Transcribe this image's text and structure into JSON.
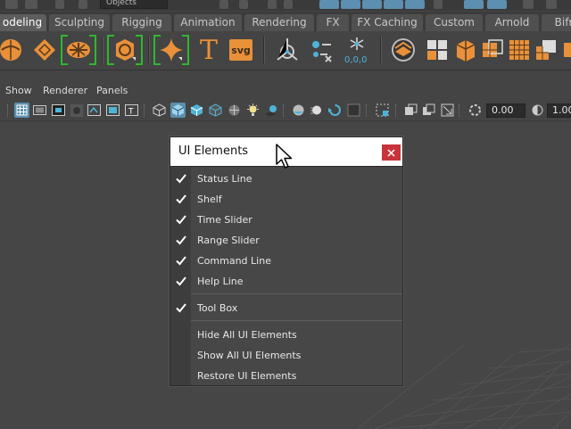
{
  "status_line": {
    "object_mode_value": "Objects"
  },
  "shelf": {
    "tabs": [
      {
        "label": "odeling",
        "active": true
      },
      {
        "label": "Sculpting",
        "active": false
      },
      {
        "label": "Rigging",
        "active": false
      },
      {
        "label": "Animation",
        "active": false
      },
      {
        "label": "Rendering",
        "active": false
      },
      {
        "label": "FX",
        "active": false
      },
      {
        "label": "FX Caching",
        "active": false
      },
      {
        "label": "Custom",
        "active": false
      },
      {
        "label": "Arnold",
        "active": false
      },
      {
        "label": "Bifr",
        "active": false
      }
    ],
    "text_icon": "T",
    "svg_icon": "svg",
    "icons": [
      "poly-sphere-icon",
      "poly-cube-icon",
      "poly-cylinder-icon",
      "poly-torus-icon",
      "poly-platonic-icon",
      "text-tool-icon",
      "svg-tool-icon",
      "measure-tool-icon",
      "type-tool-icon",
      "snowflake-icon",
      "sphere-layer-icon",
      "combine-icon",
      "separate-icon",
      "extract-icon",
      "smooth-icon",
      "bevel-icon"
    ],
    "accent_color": "#e8913a",
    "bracket_color": "#2fb82f"
  },
  "panel_menubar": {
    "items": [
      "Show",
      "Renderer",
      "Panels"
    ]
  },
  "panel_toolbar": {
    "field_1": "0.00",
    "field_2": "1.00",
    "pressed_color": "#5c8fb0"
  },
  "dialog": {
    "title": "UI Elements",
    "close_color": "#c8343a",
    "groups": [
      [
        {
          "label": "Status Line",
          "checked": true
        },
        {
          "label": "Shelf",
          "checked": true
        },
        {
          "label": "Time Slider",
          "checked": true
        },
        {
          "label": "Range Slider",
          "checked": true
        },
        {
          "label": "Command Line",
          "checked": true
        },
        {
          "label": "Help Line",
          "checked": true
        }
      ],
      [
        {
          "label": "Tool Box",
          "checked": true
        }
      ],
      [
        {
          "label": "Hide All UI Elements",
          "checked": false
        },
        {
          "label": "Show All UI Elements",
          "checked": false
        },
        {
          "label": "Restore UI Elements",
          "checked": false
        }
      ]
    ]
  }
}
